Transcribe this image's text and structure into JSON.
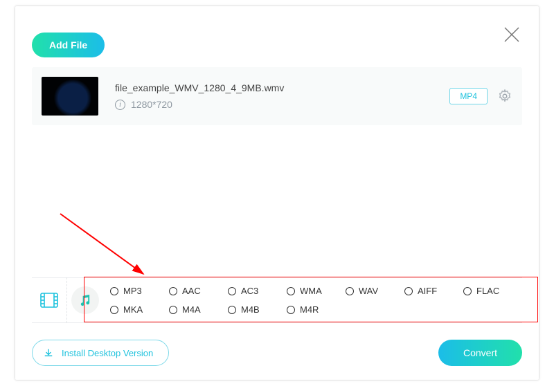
{
  "buttons": {
    "add_file": "Add File",
    "install_desktop": "Install Desktop Version",
    "convert": "Convert"
  },
  "file": {
    "name": "file_example_WMV_1280_4_9MB.wmv",
    "resolution": "1280*720",
    "output_format": "MP4"
  },
  "audio_formats_row1": [
    "MP3",
    "AAC",
    "AC3",
    "WMA",
    "WAV",
    "AIFF",
    "FLAC"
  ],
  "audio_formats_row2": [
    "MKA",
    "M4A",
    "M4B",
    "M4R"
  ],
  "colors": {
    "accent_cyan": "#1ec2dd",
    "accent_teal": "#1cc3b0",
    "gradient_start": "#21e0ab",
    "gradient_end": "#1bbde8",
    "highlight_red": "#ff0000"
  }
}
